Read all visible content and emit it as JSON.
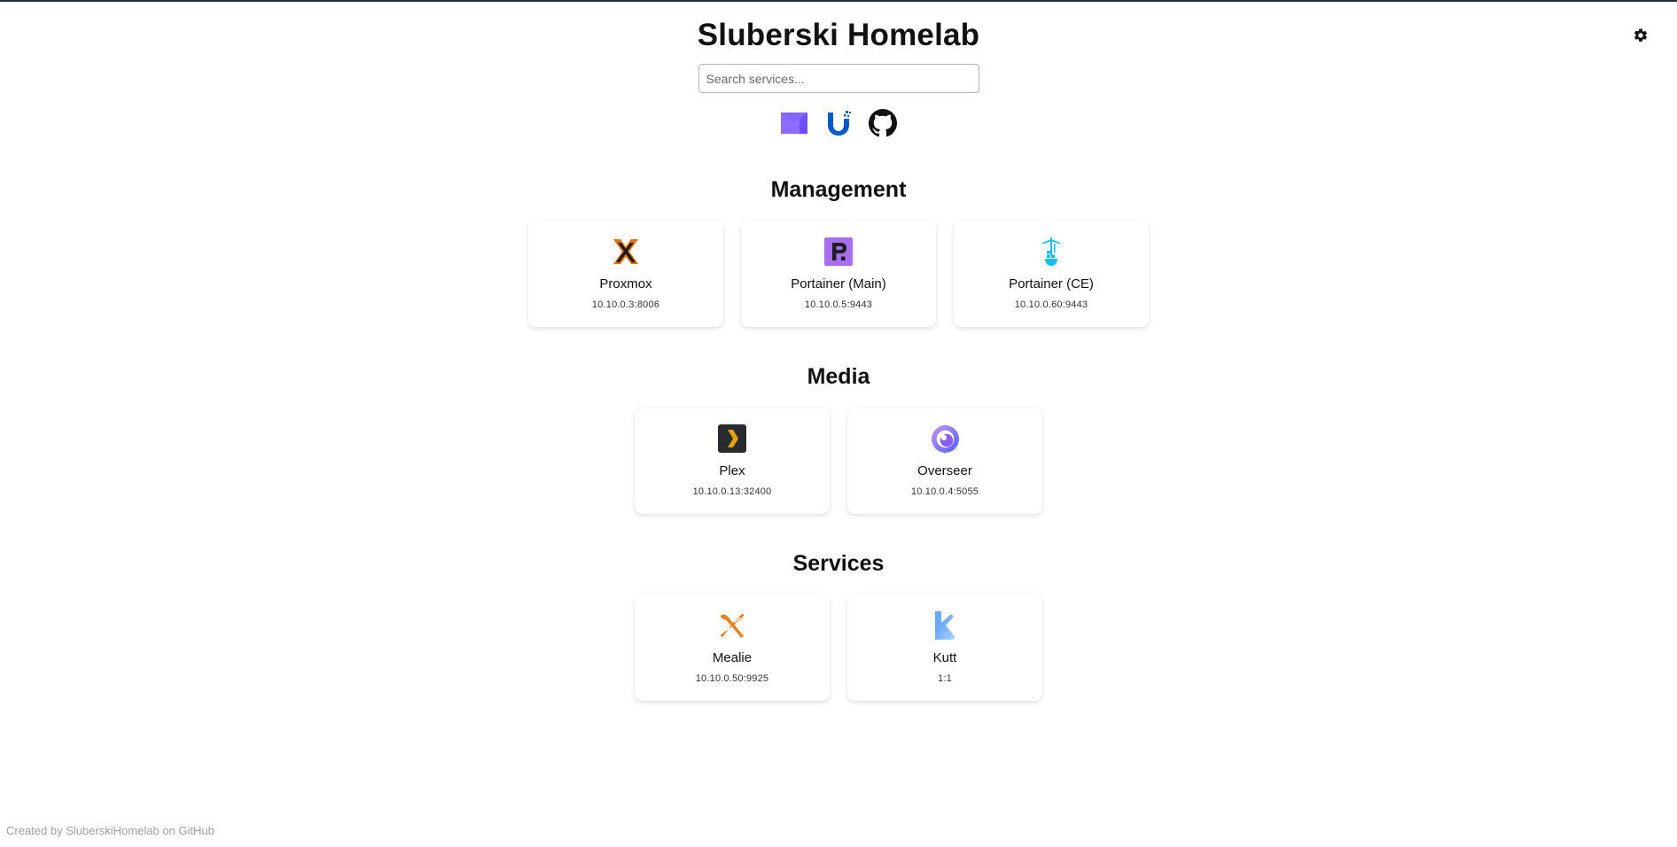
{
  "header": {
    "title": "Sluberski Homelab"
  },
  "search": {
    "placeholder": "Search services..."
  },
  "quicklinks": [
    {
      "icon": "proton-mail-icon"
    },
    {
      "icon": "unifi-icon"
    },
    {
      "icon": "github-icon"
    }
  ],
  "sections": [
    {
      "title": "Management",
      "cards": [
        {
          "name": "Proxmox",
          "address": "10.10.0.3:8006",
          "icon": "proxmox-icon"
        },
        {
          "name": "Portainer (Main)",
          "address": "10.10.0.5:9443",
          "icon": "portainer-business-icon"
        },
        {
          "name": "Portainer (CE)",
          "address": "10.10.0.60:9443",
          "icon": "portainer-ce-icon"
        }
      ]
    },
    {
      "title": "Media",
      "cards": [
        {
          "name": "Plex",
          "address": "10.10.0.13:32400",
          "icon": "plex-icon"
        },
        {
          "name": "Overseer",
          "address": "10.10.0.4:5055",
          "icon": "overseerr-icon"
        }
      ]
    },
    {
      "title": "Services",
      "cards": [
        {
          "name": "Mealie",
          "address": "10.10.0.50:9925",
          "icon": "mealie-icon"
        },
        {
          "name": "Kutt",
          "address": "1:1",
          "icon": "kutt-icon"
        }
      ]
    }
  ],
  "footer": {
    "text": "Created by SluberskiHomelab on GitHub"
  },
  "colors": {
    "proxmox_orange": "#e57000",
    "portainer_purple": "#a86ef0",
    "portainer_ce_blue": "#13bef9",
    "plex_yellow": "#e5a00d",
    "overseerr_purple": "#8b5cf6",
    "mealie_orange": "#e58325",
    "kutt_blue": "#5ea9f7",
    "unifi_blue": "#0559c9"
  }
}
